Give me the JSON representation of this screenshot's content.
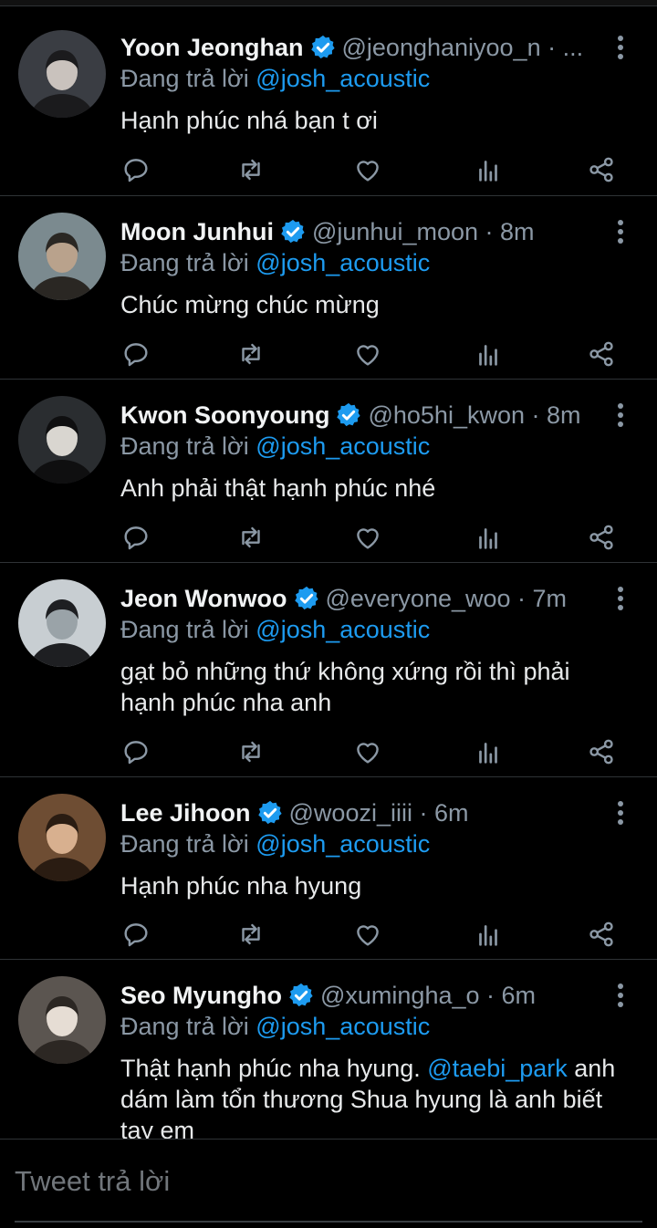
{
  "reply_prefix": "Đang trả lời",
  "reply_to": "@josh_acoustic",
  "tweets": [
    {
      "name": "Yoon Jeonghan",
      "handle": "@jeonghaniyoo_n · ...",
      "body": "Hạnh phúc nhá bạn t ơi",
      "avatar_colors": [
        "#3a3d43",
        "#c9c2bd",
        "#1b1b1d"
      ]
    },
    {
      "name": "Moon Junhui",
      "handle": "@junhui_moon · 8m",
      "body": "Chúc mừng chúc mừng",
      "avatar_colors": [
        "#7b8a8f",
        "#b9a28c",
        "#2a2723"
      ]
    },
    {
      "name": "Kwon Soonyoung",
      "handle": "@ho5hi_kwon · 8m",
      "body": "Anh phải thật hạnh phúc nhé",
      "avatar_colors": [
        "#2a2d30",
        "#d9d6d0",
        "#0f0f10"
      ]
    },
    {
      "name": "Jeon Wonwoo",
      "handle": "@everyone_woo · 7m",
      "body": "gạt bỏ những thứ không xứng rồi thì phải hạnh phúc nha anh",
      "avatar_colors": [
        "#c8ced2",
        "#9aa3a8",
        "#1e1f22"
      ]
    },
    {
      "name": "Lee Jihoon",
      "handle": "@woozi_iiii · 6m",
      "body": "Hạnh phúc nha hyung",
      "avatar_colors": [
        "#6e4d33",
        "#d8b08f",
        "#2a1c12"
      ]
    },
    {
      "name": "Seo Myungho",
      "handle": "@xumingha_o · 6m",
      "body_parts": [
        "Thật hạnh phúc nha hyung. ",
        "@taebi_park",
        " anh dám làm tổn thương Shua hyung là anh biết tay em"
      ],
      "avatar_colors": [
        "#5b5550",
        "#e6ddd4",
        "#2c2723"
      ]
    }
  ],
  "action_icons": [
    "reply-icon",
    "retweet-icon",
    "like-icon",
    "views-icon",
    "share-icon"
  ],
  "composer": {
    "placeholder": "Tweet trả lời"
  },
  "colors": {
    "accent": "#1d9bf0",
    "muted": "#8b98a5",
    "background": "#000000",
    "divider": "#2f3336"
  }
}
